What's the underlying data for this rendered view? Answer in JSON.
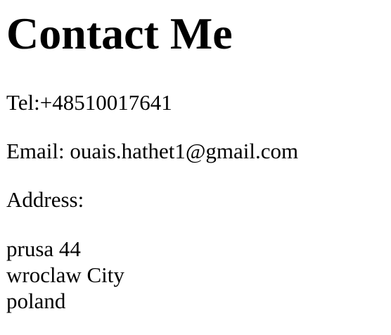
{
  "heading": "Contact Me",
  "tel": "Tel:+48510017641",
  "email": "Email: ouais.hathet1@gmail.com",
  "address_label": "Address:",
  "address_lines": [
    "prusa 44",
    "wroclaw City",
    "poland"
  ]
}
